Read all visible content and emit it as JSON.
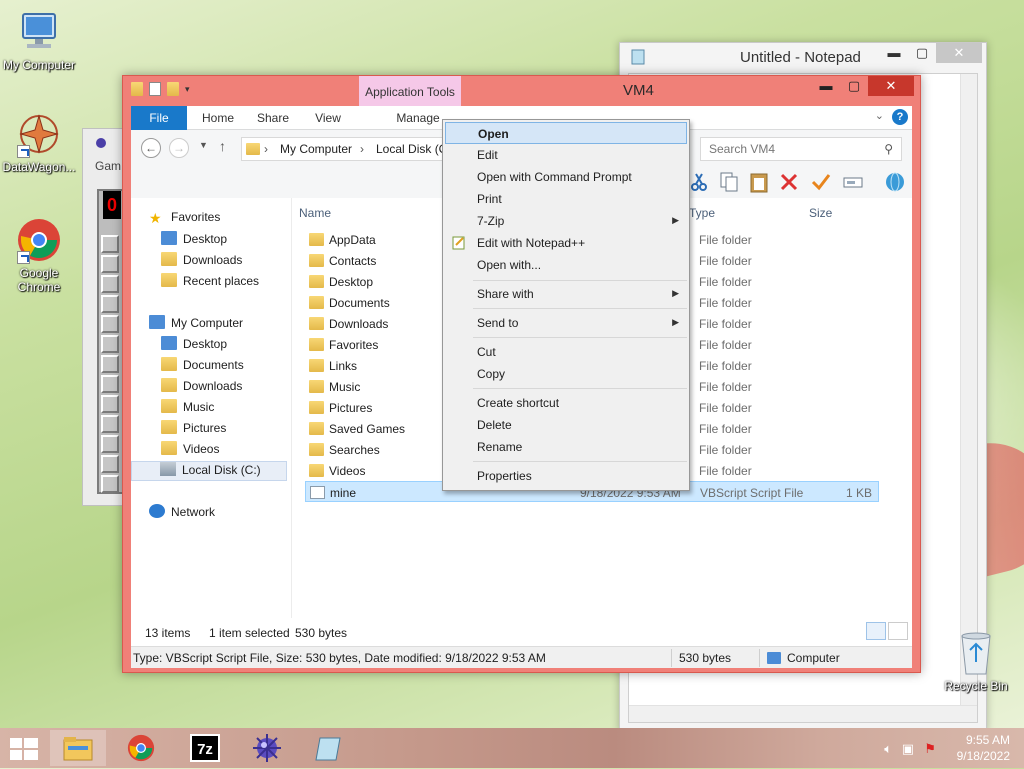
{
  "desktop": {
    "icons": [
      {
        "label": "My Computer"
      },
      {
        "label": "DataWagon..."
      },
      {
        "label": "Google Chrome"
      },
      {
        "label": "Recycle Bin"
      }
    ]
  },
  "notepad": {
    "title": "Untitled - Notepad",
    "ctrl_min": "▬",
    "ctrl_max": "▢",
    "ctrl_close": "✕"
  },
  "game": {
    "title": "Gam",
    "led": "0"
  },
  "explorer": {
    "title": "VM4",
    "context_tab": "Application Tools",
    "ctrl_min": "▬",
    "ctrl_max": "▢",
    "ctrl_close": "✕",
    "ribbon_tabs": [
      "File",
      "Home",
      "Share",
      "View",
      "Manage"
    ],
    "help": "?",
    "address": {
      "crumb1": "My Computer",
      "crumb2": "Local Disk (C"
    },
    "search_placeholder": "Search VM4",
    "nav": {
      "favorites": "Favorites",
      "fav_items": [
        "Desktop",
        "Downloads",
        "Recent places"
      ],
      "my_computer": "My Computer",
      "pc_items": [
        "Desktop",
        "Documents",
        "Downloads",
        "Music",
        "Pictures",
        "Videos",
        "Local Disk (C:)"
      ],
      "network": "Network"
    },
    "columns": {
      "name": "Name",
      "type": "Type",
      "size": "Size"
    },
    "files": [
      {
        "name": "AppData",
        "type": "File folder"
      },
      {
        "name": "Contacts",
        "type": "File folder"
      },
      {
        "name": "Desktop",
        "type": "File folder"
      },
      {
        "name": "Documents",
        "type": "File folder"
      },
      {
        "name": "Downloads",
        "type": "File folder"
      },
      {
        "name": "Favorites",
        "type": "File folder"
      },
      {
        "name": "Links",
        "type": "File folder"
      },
      {
        "name": "Music",
        "type": "File folder"
      },
      {
        "name": "Pictures",
        "type": "File folder"
      },
      {
        "name": "Saved Games",
        "type": "File folder"
      },
      {
        "name": "Searches",
        "type": "File folder"
      },
      {
        "name": "Videos",
        "type": "File folder"
      },
      {
        "name": "mine",
        "date": "9/18/2022 9:53 AM",
        "type": "VBScript Script File",
        "size": "1 KB"
      }
    ],
    "status": {
      "count": "13 items",
      "selected": "1 item selected",
      "bytes": "530 bytes",
      "details": "Type: VBScript Script File, Size: 530 bytes, Date modified: 9/18/2022 9:53 AM",
      "size2": "530 bytes",
      "location": "Computer"
    }
  },
  "context_menu": {
    "items": [
      {
        "label": "Open"
      },
      {
        "label": "Edit"
      },
      {
        "label": "Open with Command Prompt"
      },
      {
        "label": "Print"
      },
      {
        "label": "7-Zip"
      },
      {
        "label": "Edit with Notepad++"
      },
      {
        "label": "Open with..."
      },
      {
        "label": "Share with"
      },
      {
        "label": "Send to"
      },
      {
        "label": "Cut"
      },
      {
        "label": "Copy"
      },
      {
        "label": "Create shortcut"
      },
      {
        "label": "Delete"
      },
      {
        "label": "Rename"
      },
      {
        "label": "Properties"
      }
    ],
    "submenu_arrow": "▶"
  },
  "taskbar": {
    "time": "9:55 AM",
    "date": "9/18/2022"
  },
  "colors": {
    "explorer_frame": "#f08078",
    "accent_blue": "#1979ca",
    "selection": "#cce8ff"
  }
}
